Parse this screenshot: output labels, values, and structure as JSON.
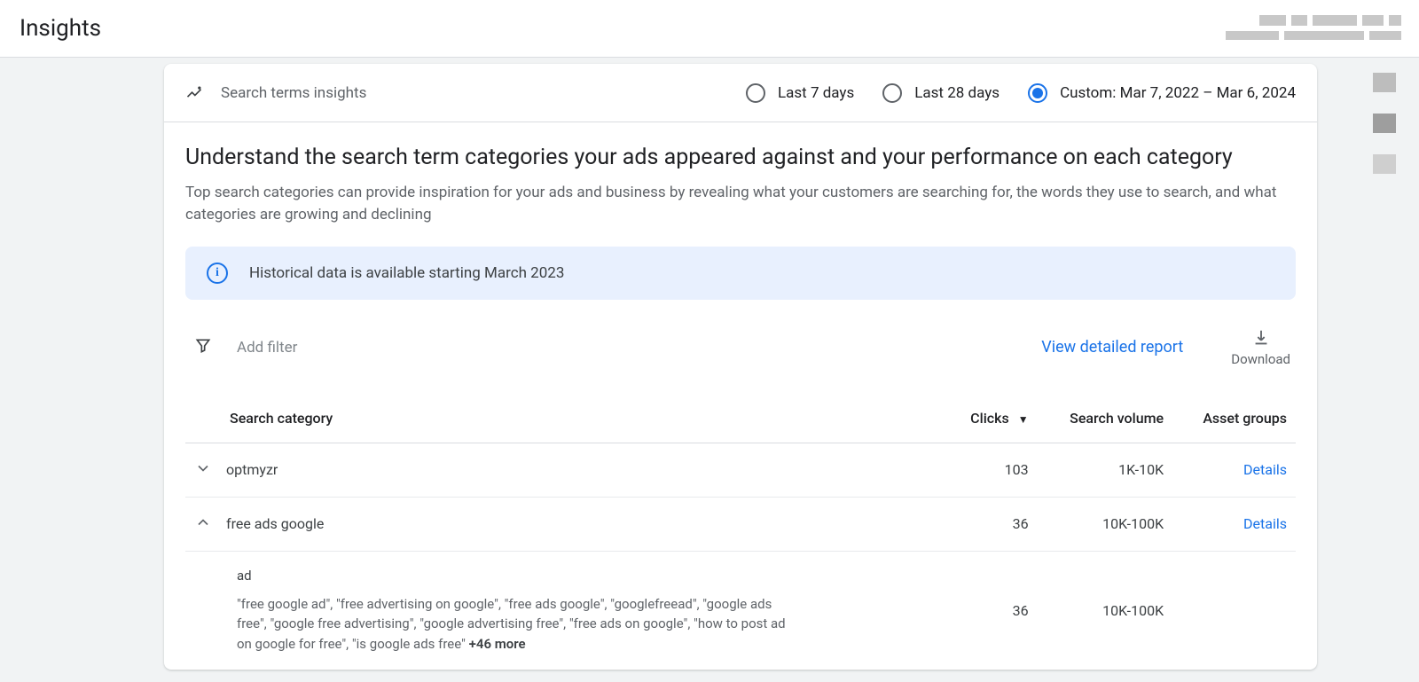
{
  "page": {
    "title": "Insights"
  },
  "card": {
    "header_title": "Search terms insights",
    "date_ranges": [
      {
        "label": "Last 7 days",
        "selected": false
      },
      {
        "label": "Last 28 days",
        "selected": false
      },
      {
        "label": "Custom: Mar 7, 2022 – Mar 6, 2024",
        "selected": true
      }
    ],
    "headline": "Understand the search term categories your ads appeared against and your performance on each category",
    "subhead": "Top search categories can provide inspiration for your ads and business by revealing what your customers are searching for, the words they use to search, and what categories are growing and declining",
    "banner": "Historical data is available starting March 2023",
    "add_filter": "Add filter",
    "view_report": "View detailed report",
    "download": "Download"
  },
  "table": {
    "columns": {
      "category": "Search category",
      "clicks": "Clicks",
      "volume": "Search volume",
      "asset_groups": "Asset groups"
    },
    "rows": [
      {
        "category": "optmyzr",
        "clicks": "103",
        "volume": "1K-10K",
        "action": "Details",
        "expanded": false
      },
      {
        "category": "free ads google",
        "clicks": "36",
        "volume": "10K-100K",
        "action": "Details",
        "expanded": true
      }
    ],
    "expanded": {
      "subcategory": "ad",
      "terms": "\"free google ad\", \"free advertising on google\", \"free ads google\", \"googlefreead\", \"google ads free\", \"google free advertising\", \"google advertising free\", \"free ads on google\", \"how to post ad on google for free\", \"is google ads free\" ",
      "more": "+46 more",
      "clicks": "36",
      "volume": "10K-100K"
    }
  }
}
